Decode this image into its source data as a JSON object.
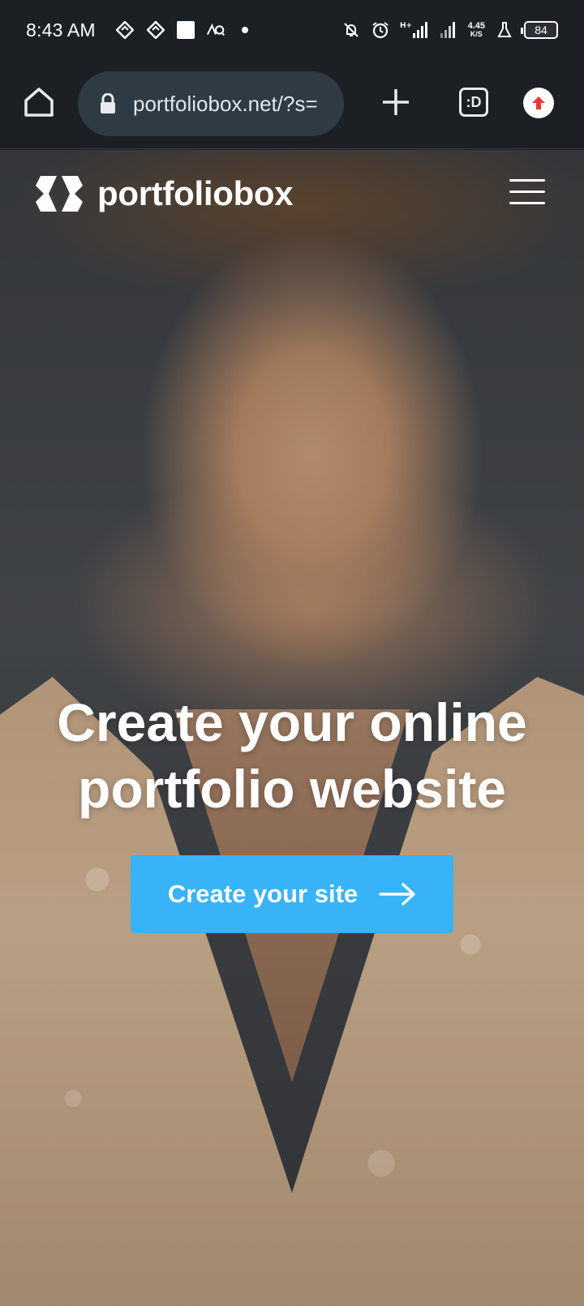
{
  "status_bar": {
    "time": "8:43 AM",
    "network_speed_value": "4.45",
    "network_speed_unit": "K/S",
    "network_type": "H+",
    "battery": "84"
  },
  "browser": {
    "url": "portfoliobox.net/?s=",
    "tab_count_label": ":D"
  },
  "site": {
    "logo_text": "portfoliobox",
    "headline_line1": "Create your online",
    "headline_line2": "portfolio website",
    "cta_label": "Create your site"
  },
  "colors": {
    "cta": "#38b3f8",
    "toolbar": "#1c2025",
    "urlbar": "#2e3a44",
    "update_badge": "#e53935"
  },
  "icons": [
    "home-icon",
    "lock-icon",
    "plus-icon",
    "tab-switcher-icon",
    "update-icon",
    "menu-icon",
    "arrow-right-icon"
  ]
}
